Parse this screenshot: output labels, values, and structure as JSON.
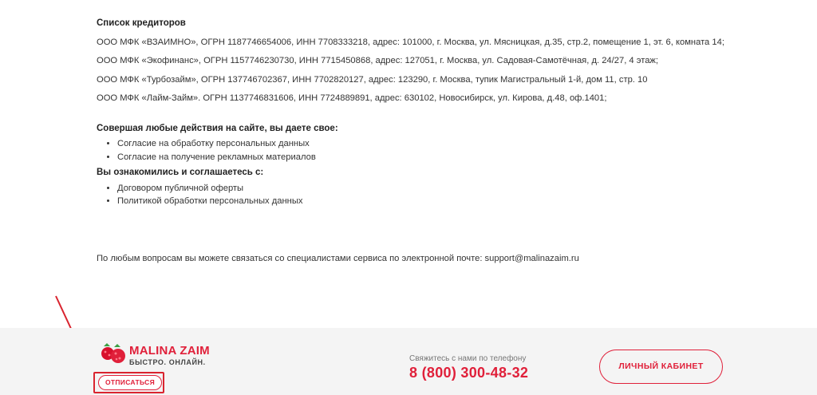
{
  "creditors": {
    "title": "Список кредиторов",
    "items": [
      "ООО МФК «ВЗАИМНО», ОГРН 1187746654006, ИНН 7708333218, адрес: 101000, г. Москва, ул. Мясницкая, д.35, стр.2, помещение 1, эт. 6, комната 14;",
      "ООО МФК «Экофинанс», ОГРН 1157746230730, ИНН 7715450868, адрес: 127051, г. Москва, ул. Садовая-Самотёчная, д. 24/27, 4 этаж;",
      "ООО МФК «Турбозайм», ОГРН 137746702367, ИНН 7702820127, адрес: 123290, г. Москва, тупик Магистральный 1-й, дом 11, стр. 10",
      "ООО МФК «Лайм-Займ». ОГРН 1137746831606, ИНН 7724889891, адрес: 630102, Новосибирск, ул. Кирова, д.48, оф.1401;"
    ]
  },
  "consent": {
    "title": "Совершая любые действия на сайте, вы даете свое:",
    "items": [
      "Согласие на обработку персональных данных",
      "Согласие на получение рекламных материалов"
    ]
  },
  "agreed": {
    "title": "Вы ознакомились и соглашаетесь с:",
    "items": [
      "Договором публичной оферты",
      "Политикой обработки персональных данных"
    ]
  },
  "support_text": "По любым вопросам вы можете связаться со специалистами сервиса по электронной почте: support@malinazaim.ru",
  "footer": {
    "brand": "MALINA ZAIM",
    "tagline": "БЫСТРО. ОНЛАЙН.",
    "unsubscribe_label": "ОТПИСАТЬСЯ",
    "contact_label": "Свяжитесь с нами по телефону",
    "phone": "8 (800) 300-48-32",
    "cabinet_label": "ЛИЧНЫЙ КАБИНЕТ"
  },
  "colors": {
    "accent": "#e0203a",
    "annotation": "#d9242f",
    "footer_bg": "#f4f4f4"
  }
}
